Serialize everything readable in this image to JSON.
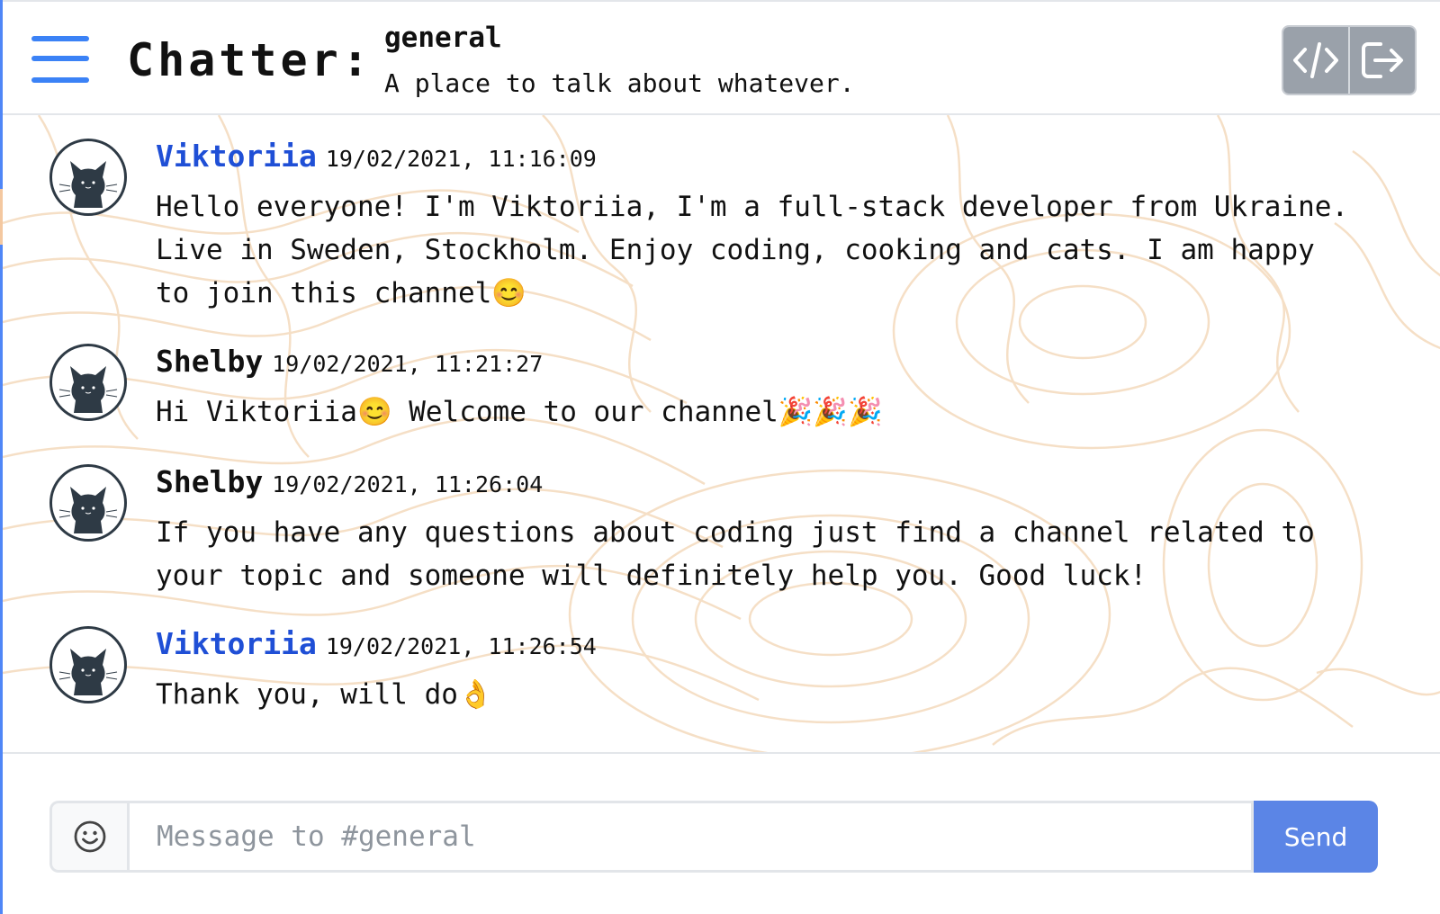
{
  "header": {
    "app_title": "Chatter:",
    "channel_name": "general",
    "channel_description": "A place to talk about whatever.",
    "buttons": [
      {
        "icon": "code-icon"
      },
      {
        "icon": "logout-icon"
      }
    ]
  },
  "messages": [
    {
      "author": "Viktoriia",
      "timestamp": "19/02/2021, 11:16:09",
      "text": "Hello everyone! I'm Viktoriia, I'm a full-stack developer from Ukraine.\nLive in Sweden, Stockholm. Enjoy coding, cooking and cats. I am happy\nto join this channel😊",
      "author_color": "#1f4fd6"
    },
    {
      "author": "Shelby",
      "timestamp": "19/02/2021, 11:21:27",
      "text": "Hi Viktoriia😊 Welcome to our channel🎉🎉🎉",
      "author_color": "#111111"
    },
    {
      "author": "Shelby",
      "timestamp": "19/02/2021, 11:26:04",
      "text": "If you have any questions about coding just find a channel related to\nyour topic and someone will definitely help you. Good luck!",
      "author_color": "#111111"
    },
    {
      "author": "Viktoriia",
      "timestamp": "19/02/2021, 11:26:54",
      "text": "Thank you, will do👌",
      "author_color": "#1f4fd6"
    }
  ],
  "composer": {
    "emoji_icon": "smiley-icon",
    "placeholder": "Message to #general",
    "value": "",
    "send_label": "Send"
  },
  "colors": {
    "accent": "#3b82f6",
    "send_button": "#5b85e6",
    "header_buttons": "#9aa1aa",
    "topo_lines": "#f5dcc0"
  }
}
